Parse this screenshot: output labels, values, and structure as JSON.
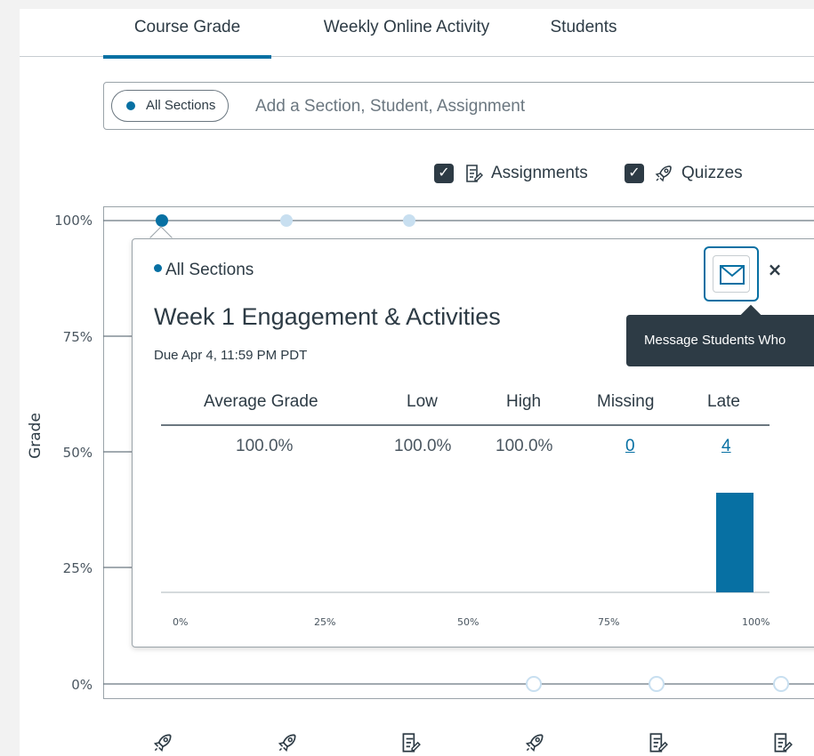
{
  "tabs": [
    {
      "label": "Course Grade",
      "active": true
    },
    {
      "label": "Weekly Online Activity",
      "active": false
    },
    {
      "label": "Students",
      "active": false
    }
  ],
  "filter": {
    "pill_label": "All Sections",
    "placeholder": "Add a Section, Student, Assignment"
  },
  "legend": {
    "assignments_label": "Assignments",
    "quizzes_label": "Quizzes",
    "assignments_checked": true,
    "quizzes_checked": true
  },
  "chart": {
    "ylabel": "Grade",
    "yticks": [
      "100%",
      "75%",
      "50%",
      "25%",
      "0%"
    ],
    "bottom_icons": [
      "rocket-icon",
      "rocket-icon",
      "assignment-icon",
      "rocket-icon",
      "assignment-icon",
      "assignment-icon"
    ]
  },
  "popup": {
    "section": "All Sections",
    "title": "Week 1 Engagement & Activities",
    "due": "Due Apr 4, 11:59 PM PDT",
    "close": "×",
    "headers": {
      "average": "Average Grade",
      "low": "Low",
      "high": "High",
      "missing": "Missing",
      "late": "Late"
    },
    "values": {
      "average": "100.0%",
      "low": "100.0%",
      "high": "100.0%",
      "missing": "0",
      "late": "4"
    },
    "histogram_xticks": [
      "0%",
      "25%",
      "50%",
      "75%",
      "100%"
    ],
    "histogram_bar_fraction": 0.8
  },
  "tooltip": "Message Students Who",
  "colors": {
    "accent": "#0770a3",
    "text": "#2d3b45",
    "tooltip_bg": "#2d3b45"
  }
}
